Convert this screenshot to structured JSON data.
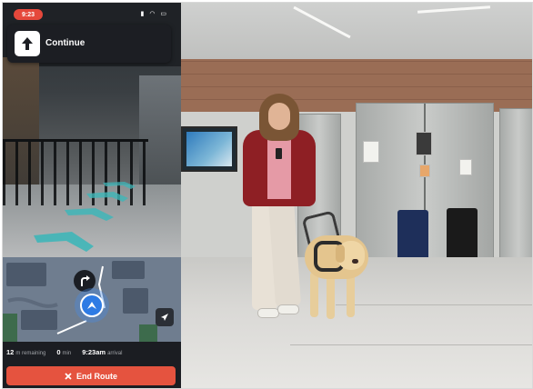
{
  "status_bar": {
    "time": "9:23",
    "icons": [
      "signal-icon",
      "wifi-icon",
      "battery-icon"
    ]
  },
  "navigation": {
    "instruction_icon": "straight-arrow-icon",
    "instruction_text": "Continue"
  },
  "map": {
    "turn_icon": "turn-right-icon",
    "location_icon": "navigation-arrow-icon",
    "recenter_icon": "location-arrow-icon"
  },
  "stats": {
    "distance_value": "12",
    "distance_label": "m remaining",
    "time_value": "0",
    "time_label": "min",
    "arrival_value": "9:23am",
    "arrival_label": "arrival"
  },
  "actions": {
    "end_route_icon": "close-icon",
    "end_route_label": "End Route"
  },
  "colors": {
    "accent": "#e5533f",
    "location_blue": "#2e7be4",
    "chevron_teal": "#3fb6b8",
    "card_dark": "#1c1e23"
  }
}
